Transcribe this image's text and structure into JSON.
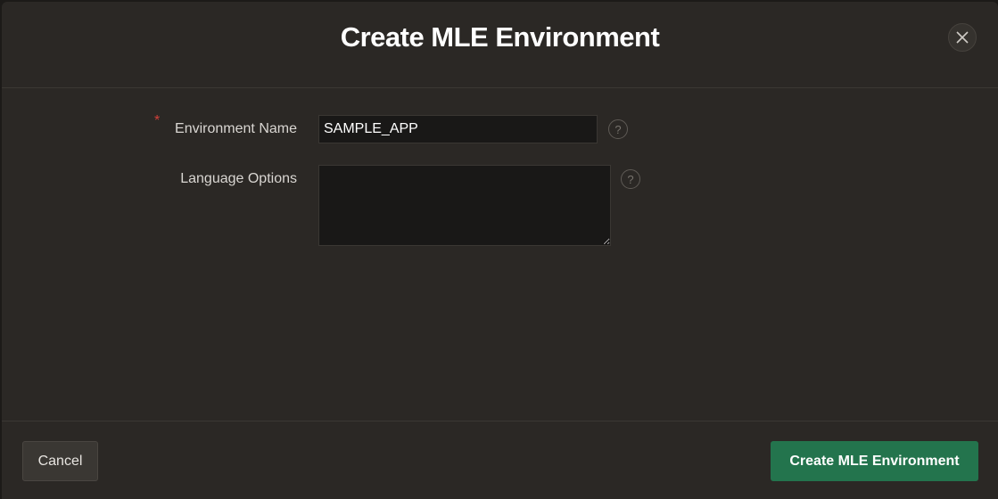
{
  "dialog": {
    "title": "Create MLE Environment",
    "close_icon": "close-icon"
  },
  "form": {
    "environment_name": {
      "label": "Environment Name",
      "required_marker": "*",
      "value": "SAMPLE_APP",
      "help": "?"
    },
    "language_options": {
      "label": "Language Options",
      "value": "",
      "help": "?"
    }
  },
  "footer": {
    "cancel_label": "Cancel",
    "create_label": "Create MLE Environment"
  },
  "colors": {
    "background": "#2b2825",
    "primary_button": "#23744d",
    "required": "#d0403a"
  }
}
